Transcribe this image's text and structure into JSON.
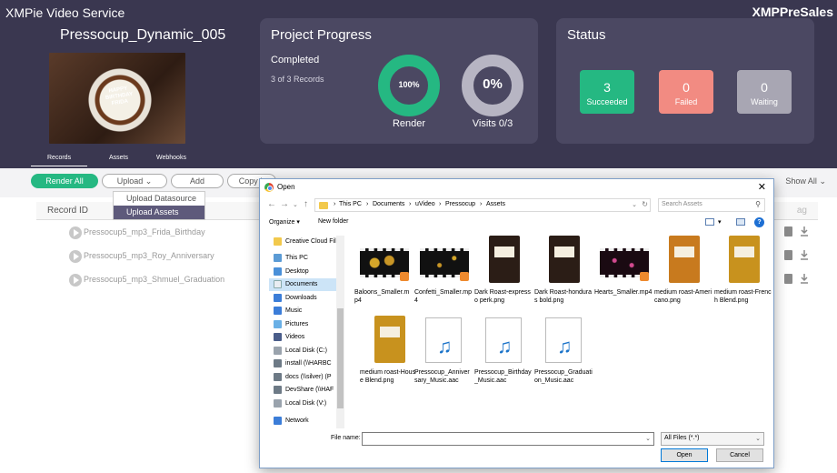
{
  "app": {
    "title": "XMPie Video Service",
    "user": "XMPPreSales"
  },
  "job": {
    "name": "Pressocup_Dynamic_005",
    "thumb_text": "HAPPY BIRTHDAY FRIDA"
  },
  "progress": {
    "title": "Project Progress",
    "label": "Completed",
    "records": "3 of 3 Records",
    "render_value": "100%",
    "render_caption": "Render",
    "visits_value": "0%",
    "visits_caption": "Visits 0/3"
  },
  "status": {
    "title": "Status",
    "succeeded_count": "3",
    "succeeded_label": "Succeeded",
    "failed_count": "0",
    "failed_label": "Failed",
    "waiting_count": "0",
    "waiting_label": "Waiting"
  },
  "tabs": [
    "Records",
    "Assets",
    "Webhooks"
  ],
  "toolbar": {
    "render_all": "Render All",
    "upload": "Upload",
    "add": "Add",
    "copy": "Copy L",
    "show_all": "Show All"
  },
  "upload_menu": [
    "Upload Datasource",
    "Upload Assets"
  ],
  "table": {
    "col_record_id": "Record ID",
    "col_right": "ag",
    "rows": [
      "Pressocup5_mp3_Frida_Birthday",
      "Pressocup5_mp3_Roy_Anniversary",
      "Pressocup5_mp3_Shmuel_Graduation"
    ]
  },
  "dialog": {
    "title": "Open",
    "close": "✕",
    "breadcrumb": [
      "This PC",
      "Documents",
      "uVideo",
      "Pressocup",
      "Assets"
    ],
    "search_placeholder": "Search Assets",
    "organize": "Organize ▾",
    "new_folder": "New folder",
    "nav": [
      "Creative Cloud Fil",
      "This PC",
      "Desktop",
      "Documents",
      "Downloads",
      "Music",
      "Pictures",
      "Videos",
      "Local Disk (C:)",
      "install (\\\\HARBC",
      "docs (\\\\silver) (P",
      "DevShare (\\\\HAF",
      "Local Disk (V:)",
      "Network"
    ],
    "files": [
      "Baloons_Smaller.mp4",
      "Confetti_Smaller.mp4",
      "Dark Roast-expresso perk.png",
      "Dark Roast-honduras bold.png",
      "Hearts_Smaller.mp4",
      "medium roast-Americano.png",
      "medium roast-French Blend.png",
      "medium roast-House Blend.png",
      "Pressocup_Anniversary_Music.aac",
      "Pressocup_Birthday_Music.aac",
      "Pressocup_Graduation_Music.aac"
    ],
    "file_name_label": "File name:",
    "file_name_value": "",
    "file_type": "All Files (*.*)",
    "open": "Open",
    "cancel": "Cancel"
  },
  "colors": {
    "header_bg": "#3a3750",
    "panel_bg": "#4b4862",
    "accent_green": "#25b882",
    "failed_red": "#f28b82",
    "waiting_gray": "#a8a6b3",
    "menu_active": "#5e5a7b"
  }
}
